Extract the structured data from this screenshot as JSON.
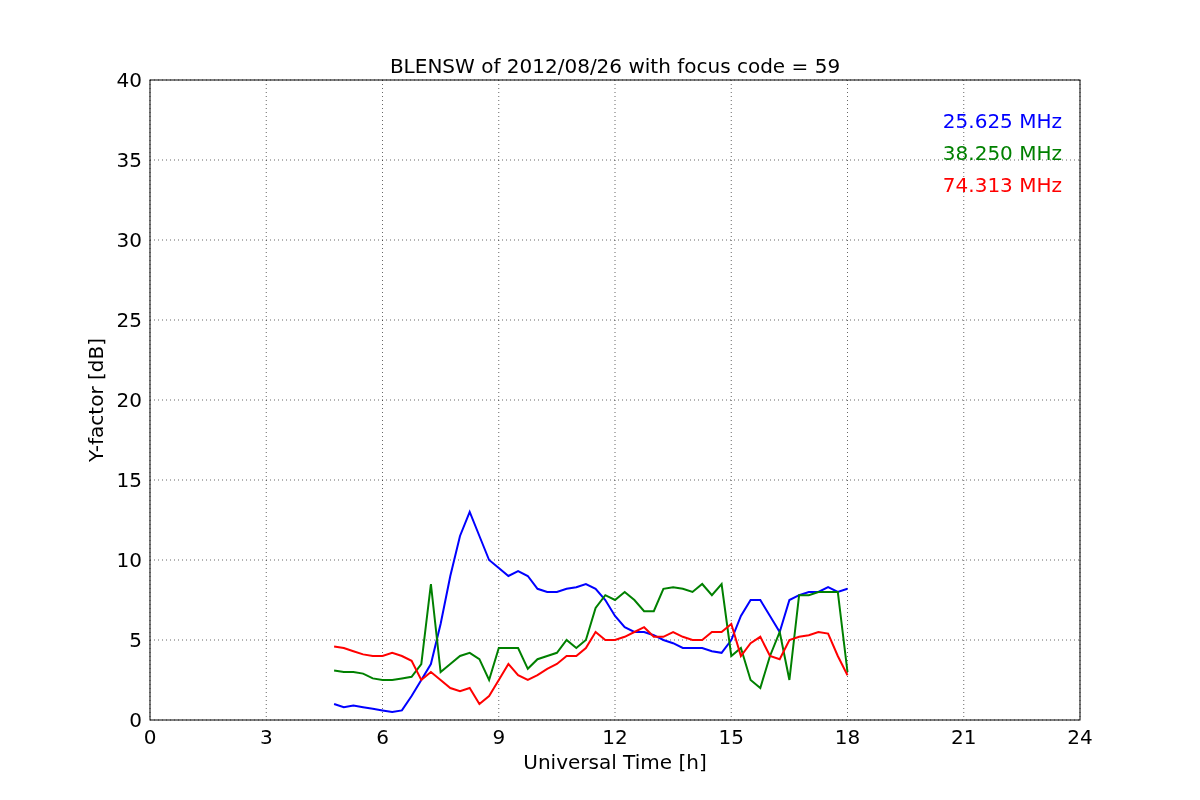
{
  "figure": {
    "chart_data": {
      "type": "line",
      "title": "BLENSW of 2012/08/26 with focus code = 59",
      "xlabel": "Universal Time [h]",
      "ylabel": "Y-factor [dB]",
      "xlim": [
        0,
        24
      ],
      "ylim": [
        0,
        40
      ],
      "xticks": [
        0,
        3,
        6,
        9,
        12,
        15,
        18,
        21,
        24
      ],
      "yticks": [
        0,
        5,
        10,
        15,
        20,
        25,
        30,
        35,
        40
      ],
      "grid": true,
      "x": [
        4.75,
        5,
        5.25,
        5.5,
        5.75,
        6,
        6.25,
        6.5,
        6.75,
        7,
        7.25,
        7.5,
        7.75,
        8,
        8.25,
        8.5,
        8.75,
        9,
        9.25,
        9.5,
        9.75,
        10,
        10.25,
        10.5,
        10.75,
        11,
        11.25,
        11.5,
        11.75,
        12,
        12.25,
        12.5,
        12.75,
        13,
        13.25,
        13.5,
        13.75,
        14,
        14.25,
        14.5,
        14.75,
        15,
        15.25,
        15.5,
        15.75,
        16,
        16.25,
        16.5,
        16.75,
        17,
        17.25,
        17.5,
        17.75,
        18
      ],
      "series": [
        {
          "name": "25.625 MHz",
          "color": "#0000ff",
          "values": [
            1,
            0.8,
            0.9,
            0.8,
            0.7,
            0.6,
            0.5,
            0.6,
            1.5,
            2.5,
            3.5,
            6,
            9,
            11.5,
            13,
            11.5,
            10,
            9.5,
            9,
            9.3,
            9,
            8.2,
            8,
            8,
            8.2,
            8.3,
            8.5,
            8.2,
            7.5,
            6.5,
            5.8,
            5.5,
            5.5,
            5.3,
            5,
            4.8,
            4.5,
            4.5,
            4.5,
            4.3,
            4.2,
            5,
            6.5,
            7.5,
            7.5,
            6.5,
            5.5,
            7.5,
            7.8,
            8,
            8,
            8.3,
            8,
            8.2
          ]
        },
        {
          "name": "38.250 MHz",
          "color": "#008000",
          "values": [
            3.1,
            3,
            3,
            2.9,
            2.6,
            2.5,
            2.5,
            2.6,
            2.7,
            3.5,
            8.5,
            3,
            3.5,
            4,
            4.2,
            3.8,
            2.5,
            4.5,
            4.5,
            4.5,
            3.2,
            3.8,
            4,
            4.2,
            5,
            4.5,
            5,
            7,
            7.8,
            7.5,
            8,
            7.5,
            6.8,
            6.8,
            8.2,
            8.3,
            8.2,
            8,
            8.5,
            7.8,
            8.5,
            4,
            4.5,
            2.5,
            2,
            4,
            5.5,
            2.5,
            7.8,
            7.8,
            8,
            8,
            8,
            3
          ]
        },
        {
          "name": "74.313 MHz",
          "color": "#ff0000",
          "values": [
            4.6,
            4.5,
            4.3,
            4.1,
            4,
            4,
            4.2,
            4,
            3.7,
            2.5,
            3,
            2.5,
            2,
            1.8,
            2,
            1,
            1.5,
            2.5,
            3.5,
            2.8,
            2.5,
            2.8,
            3.2,
            3.5,
            4,
            4,
            4.5,
            5.5,
            5,
            5,
            5.2,
            5.5,
            5.8,
            5.2,
            5.2,
            5.5,
            5.2,
            5,
            5,
            5.5,
            5.5,
            6,
            4,
            4.8,
            5.2,
            4,
            3.8,
            5,
            5.2,
            5.3,
            5.5,
            5.4,
            4,
            2.8
          ]
        }
      ]
    }
  }
}
